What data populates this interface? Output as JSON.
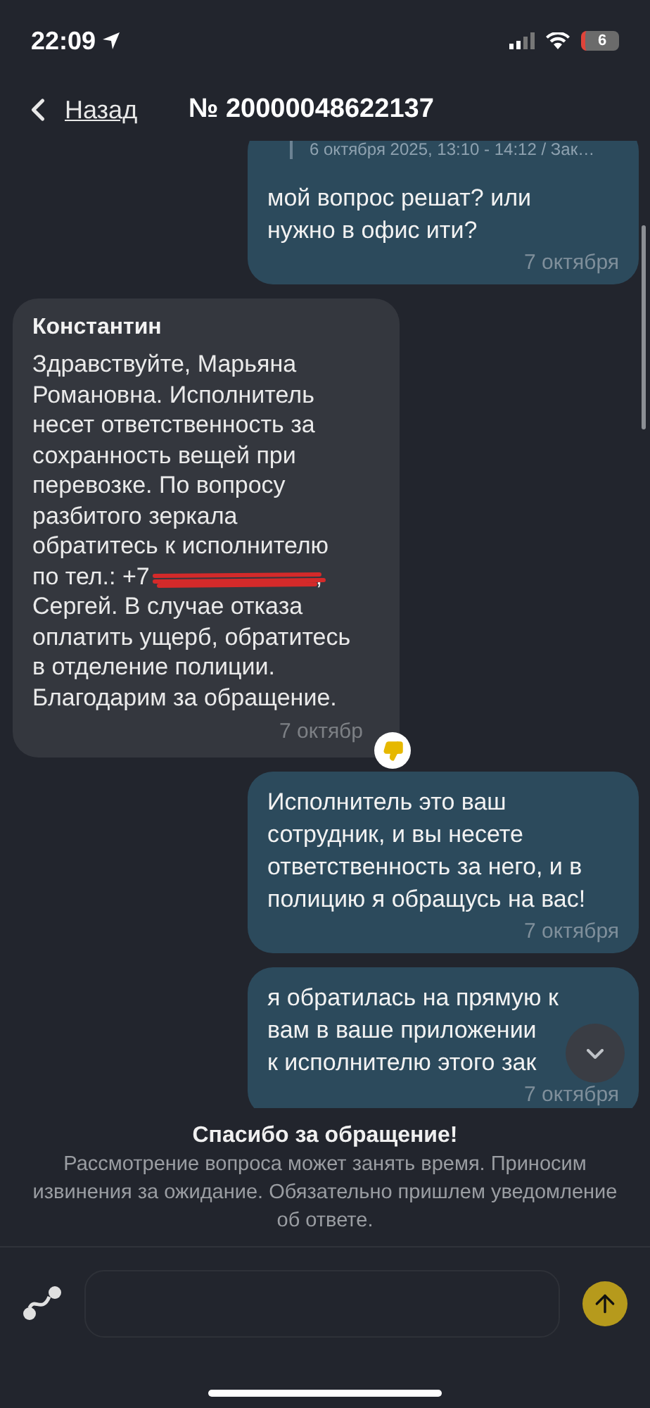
{
  "status_bar": {
    "time": "22:09",
    "battery": "6"
  },
  "header": {
    "back": "Назад",
    "title": "№ 20000048622137"
  },
  "messages": [
    {
      "kind": "outgoing",
      "quote": "6 октября 2025, 13:10 - 14:12 / Зак…",
      "lines": [
        "мой вопрос решат? или",
        "нужно в офис ити?"
      ],
      "time": "7 октября"
    },
    {
      "kind": "incoming",
      "author": "Константин",
      "lines": [
        "Здравствуйте, Марьяна",
        "Романовна. Исполнитель",
        "несет ответственность за",
        "сохранность вещей при",
        "перевозке. По вопросу",
        "разбитого зеркала",
        "обратитесь к исполнителю",
        {
          "text": "по тел.: +7",
          "redacted": true,
          "after": ","
        },
        "Сергей. В случае отказа",
        "оплатить ущерб, обратитесь",
        "в отделение полиции.",
        "Благодарим за обращение."
      ],
      "time": "7 октябр",
      "reaction": {
        "kind": "dislike"
      }
    },
    {
      "kind": "outgoing",
      "lines": [
        "Исполнитель это ваш",
        "сотрудник, и вы несете",
        "ответственность за него, и в",
        "полицию я обращусь на вас!"
      ],
      "time": "7 октября"
    },
    {
      "kind": "outgoing",
      "lines": [
        "я обратилась на прямую к",
        "вам в ваше приложении",
        "к исполнителю этого зак"
      ],
      "time": "7 октября"
    }
  ],
  "notice": {
    "title": "Спасибо за обращение!",
    "text": "Рассмотрение вопроса может занять время. Приносим извинения за ожидание. Обязательно пришлем уведомление об ответе."
  }
}
